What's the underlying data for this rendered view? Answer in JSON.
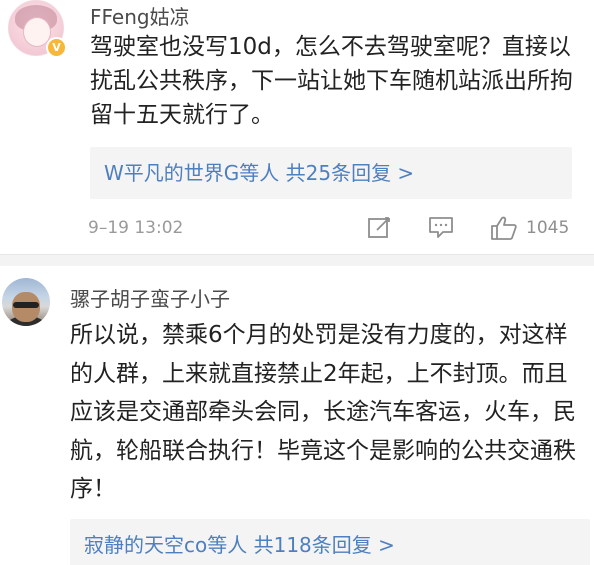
{
  "comments": [
    {
      "username": "FFeng姑凉",
      "text": "驾驶室也没写10d，怎么不去驾驶室呢？直接以扰乱公共秩序，下一站让她下车随机站派出所拘留十五天就行了。",
      "reply_summary": "W平凡的世界G等人  共25条回复 >",
      "timestamp": "9–19 13:02",
      "like_count": "1045",
      "verified_badge": "V"
    },
    {
      "username": "骡子胡子蛮子小子",
      "text": "所以说，禁乘6个月的处罚是没有力度的，对这样的人群，上来就直接禁止2年起，上不封顶。而且应该是交通部牵头会同，长途汽车客运，火车，民航，轮船联合执行！毕竟这个是影响的公共交通秩序！",
      "reply_summary": "寂静的天空co等人  共118条回复 >"
    }
  ],
  "colors": {
    "link_blue": "#4e7fbf",
    "meta_gray": "#9a9a9a",
    "reply_bg": "#f4f4f4",
    "badge_orange": "#f6b73c"
  },
  "icons": {
    "share": "edit-share-icon",
    "comment": "comment-icon",
    "like": "thumbs-up-icon"
  }
}
